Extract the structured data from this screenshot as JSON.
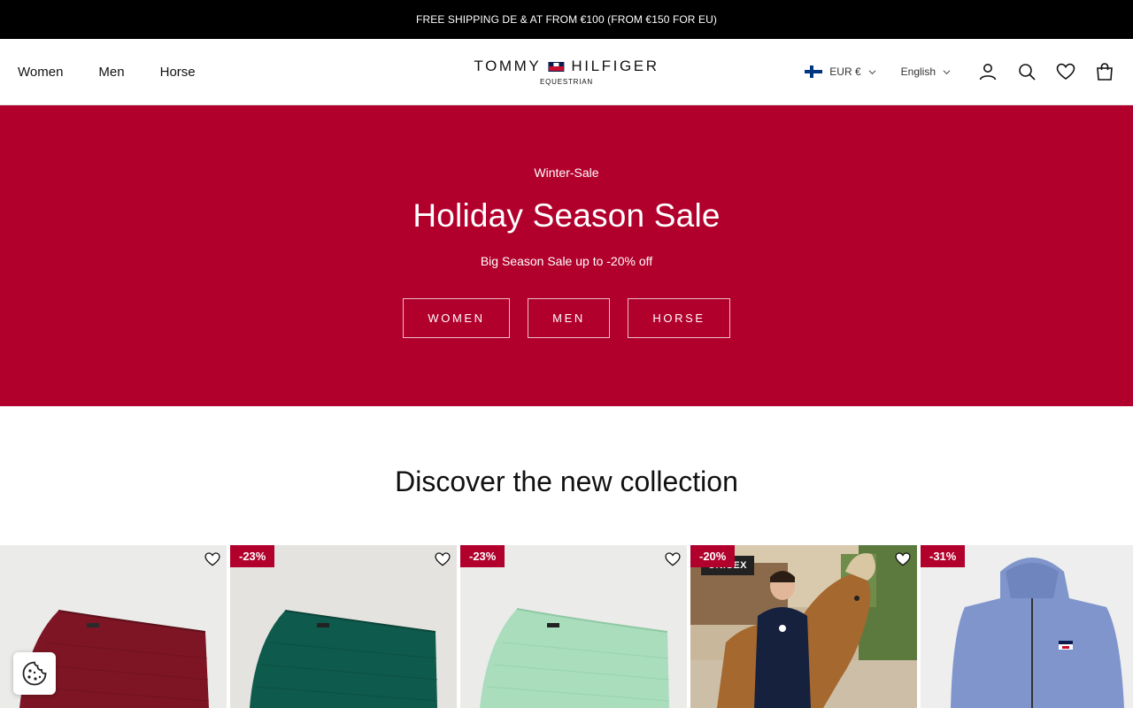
{
  "announcement": "FREE SHIPPING DE & AT FROM €100 (FROM €150 FOR EU)",
  "nav": {
    "women": "Women",
    "men": "Men",
    "horse": "Horse"
  },
  "logo": {
    "brand_left": "TOMMY",
    "brand_right": "HILFIGER",
    "sub": "EQUESTRIAN"
  },
  "locale": {
    "currency": "EUR €",
    "language": "English"
  },
  "icons": [
    "account-icon",
    "search-icon",
    "wishlist-heart-icon",
    "cart-bag-icon"
  ],
  "hero": {
    "kicker": "Winter-Sale",
    "title": "Holiday Season Sale",
    "subtitle": "Big Season Sale up to -20% off",
    "buttons": [
      "WOMEN",
      "MEN",
      "HORSE"
    ],
    "bg_color": "#b2002c"
  },
  "section": {
    "title": "Discover the new collection"
  },
  "products": [
    {
      "badge": "",
      "tag": ""
    },
    {
      "badge": "-23%",
      "tag": ""
    },
    {
      "badge": "-23%",
      "tag": ""
    },
    {
      "badge": "-20%",
      "tag": "UNISEX"
    },
    {
      "badge": "-31%",
      "tag": ""
    }
  ],
  "colors": {
    "accent": "#b2002c",
    "topbar": "#000000"
  }
}
